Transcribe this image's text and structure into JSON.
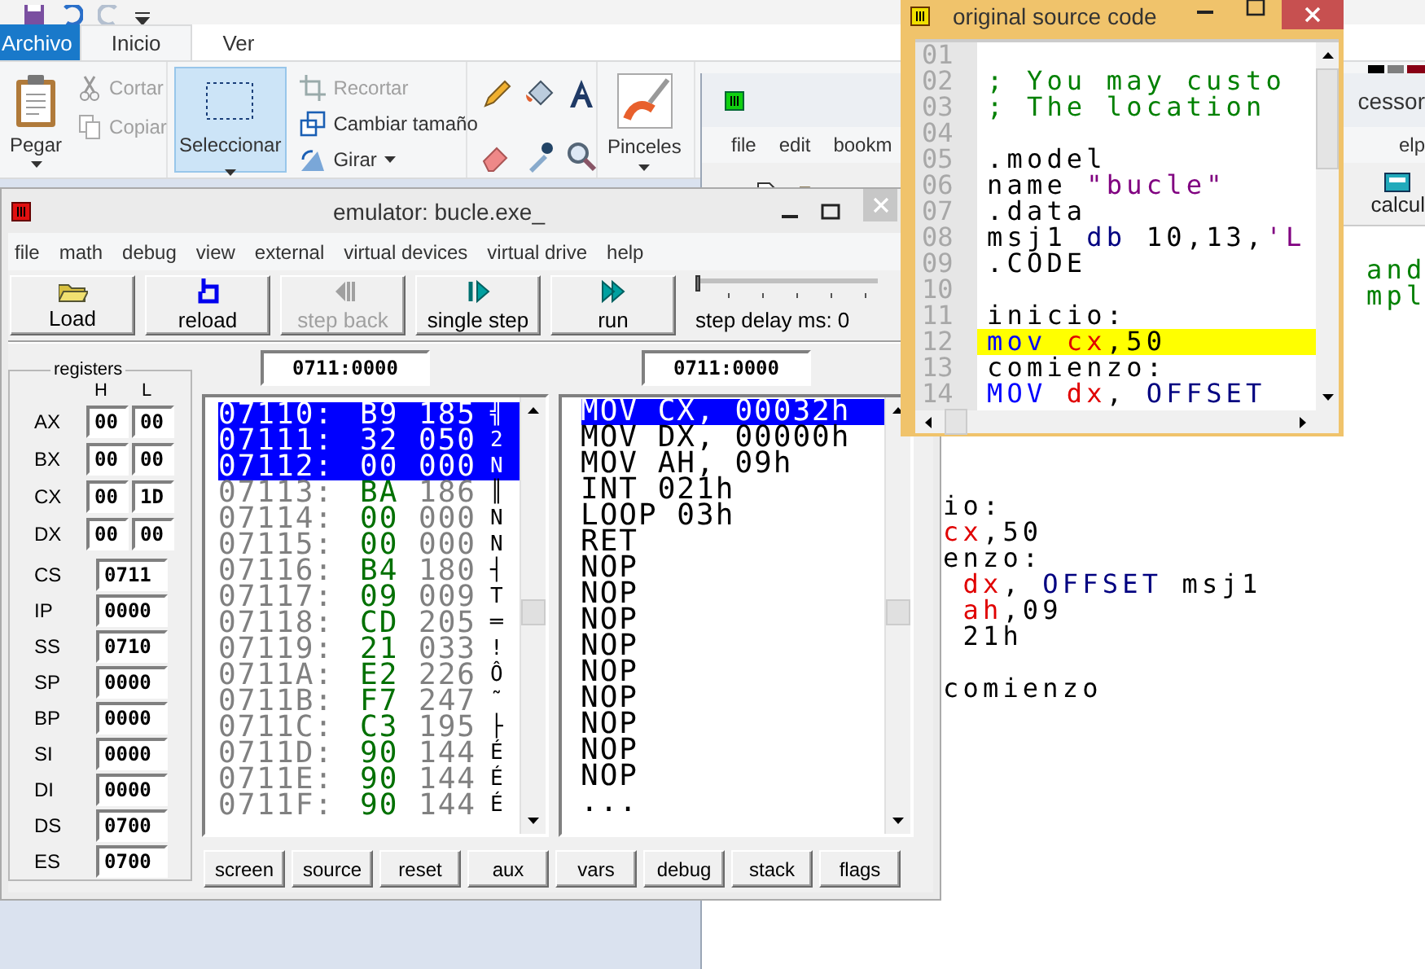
{
  "paint": {
    "tabs": [
      {
        "label": "Archivo",
        "kind": "file",
        "selected": false
      },
      {
        "label": "Inicio",
        "kind": "tab",
        "selected": true
      },
      {
        "label": "Ver",
        "kind": "tab",
        "selected": false
      }
    ],
    "clipboard": {
      "paste": "Pegar",
      "items": [
        {
          "label": "Cortar",
          "kind": "cut",
          "disabled": true
        },
        {
          "label": "Copiar",
          "kind": "copy",
          "disabled": true
        }
      ]
    },
    "image": {
      "select": {
        "label": "Seleccionar",
        "selected": true
      },
      "items": [
        {
          "label": "Recortar",
          "kind": "crop",
          "disabled": true
        },
        {
          "label": "Cambiar tamaño",
          "kind": "resize",
          "disabled": false
        },
        {
          "label": "Girar",
          "kind": "rotate",
          "disabled": false
        }
      ]
    },
    "brushes": "Pinceles"
  },
  "editor": {
    "title": "cessor",
    "menu": [
      "file",
      "edit",
      "bookm"
    ],
    "menu_right": "elp",
    "tool": "calcul",
    "side_lines": [
      {
        "text": "and",
        "kind": "comment"
      },
      {
        "text": "mpl",
        "kind": "comment"
      }
    ],
    "blocks": [
      {
        "lines": [
          {
            "segments": [
              {
                "text": "io:",
                "kind": "plain"
              }
            ]
          },
          {
            "segments": [
              {
                "text": "cx",
                "kind": "reg"
              },
              {
                "text": ",50",
                "kind": "plain"
              }
            ]
          },
          {
            "segments": [
              {
                "text": "enzo:",
                "kind": "plain"
              }
            ]
          },
          {
            "segments": [
              {
                "text": " dx",
                "kind": "reg"
              },
              {
                "text": ", ",
                "kind": "plain"
              },
              {
                "text": "OFFSET",
                "kind": "keyword"
              },
              {
                "text": " msj1",
                "kind": "plain"
              }
            ]
          },
          {
            "segments": [
              {
                "text": " ah",
                "kind": "reg"
              },
              {
                "text": ",09",
                "kind": "plain"
              }
            ]
          },
          {
            "segments": [
              {
                "text": " 21h",
                "kind": "plain"
              }
            ]
          }
        ]
      },
      {
        "lines": [
          {
            "segments": [
              {
                "text": "comienzo",
                "kind": "plain"
              }
            ]
          }
        ]
      }
    ]
  },
  "emulator": {
    "title": "emulator: bucle.exe_",
    "menu": [
      "file",
      "math",
      "debug",
      "view",
      "external",
      "virtual devices",
      "virtual drive",
      "help"
    ],
    "toolbar": [
      {
        "label": "Load",
        "kind": "load",
        "disabled": false
      },
      {
        "label": "reload",
        "kind": "reload",
        "disabled": false
      },
      {
        "label": "step back",
        "kind": "back",
        "disabled": true
      },
      {
        "label": "single step",
        "kind": "step",
        "disabled": false
      },
      {
        "label": "run",
        "kind": "run",
        "disabled": false
      }
    ],
    "step_delay": {
      "label": "step delay ms: 0",
      "level": 0
    },
    "registers": {
      "title": "registers",
      "columns": [
        "H",
        "L"
      ],
      "pairs": [
        {
          "name": "AX",
          "high": "00",
          "low": "00"
        },
        {
          "name": "BX",
          "high": "00",
          "low": "00"
        },
        {
          "name": "CX",
          "high": "00",
          "low": "1D"
        },
        {
          "name": "DX",
          "high": "00",
          "low": "00"
        }
      ],
      "words": [
        {
          "name": "CS",
          "value": "0711"
        },
        {
          "name": "IP",
          "value": "0000"
        },
        {
          "name": "SS",
          "value": "0710"
        },
        {
          "name": "SP",
          "value": "0000"
        },
        {
          "name": "BP",
          "value": "0000"
        },
        {
          "name": "SI",
          "value": "0000"
        },
        {
          "name": "DI",
          "value": "0000"
        },
        {
          "name": "DS",
          "value": "0700"
        },
        {
          "name": "ES",
          "value": "0700"
        }
      ]
    },
    "memory": {
      "address": "0711:0000",
      "rows": [
        {
          "address": "07110:",
          "hex": "B9",
          "dec": "185",
          "char": "╣",
          "selected": true
        },
        {
          "address": "07111:",
          "hex": "32",
          "dec": "050",
          "char": "2",
          "selected": true
        },
        {
          "address": "07112:",
          "hex": "00",
          "dec": "000",
          "char": "N",
          "selected": true
        },
        {
          "address": "07113:",
          "hex": "BA",
          "dec": "186",
          "char": "║",
          "selected": false
        },
        {
          "address": "07114:",
          "hex": "00",
          "dec": "000",
          "char": "N",
          "selected": false
        },
        {
          "address": "07115:",
          "hex": "00",
          "dec": "000",
          "char": "N",
          "selected": false
        },
        {
          "address": "07116:",
          "hex": "B4",
          "dec": "180",
          "char": "┤",
          "selected": false
        },
        {
          "address": "07117:",
          "hex": "09",
          "dec": "009",
          "char": "T",
          "selected": false
        },
        {
          "address": "07118:",
          "hex": "CD",
          "dec": "205",
          "char": "═",
          "selected": false
        },
        {
          "address": "07119:",
          "hex": "21",
          "dec": "033",
          "char": "!",
          "selected": false
        },
        {
          "address": "0711A:",
          "hex": "E2",
          "dec": "226",
          "char": "Ô",
          "selected": false
        },
        {
          "address": "0711B:",
          "hex": "F7",
          "dec": "247",
          "char": "˜",
          "selected": false
        },
        {
          "address": "0711C:",
          "hex": "C3",
          "dec": "195",
          "char": "├",
          "selected": false
        },
        {
          "address": "0711D:",
          "hex": "90",
          "dec": "144",
          "char": "É",
          "selected": false
        },
        {
          "address": "0711E:",
          "hex": "90",
          "dec": "144",
          "char": "É",
          "selected": false
        },
        {
          "address": "0711F:",
          "hex": "90",
          "dec": "144",
          "char": "É",
          "selected": false
        }
      ]
    },
    "disassembly": {
      "address": "0711:0000",
      "rows": [
        {
          "text": "MOV CX, 00032h",
          "selected": true
        },
        {
          "text": "MOV DX, 00000h",
          "selected": false
        },
        {
          "text": "MOV AH, 09h",
          "selected": false
        },
        {
          "text": "INT 021h",
          "selected": false
        },
        {
          "text": "LOOP 03h",
          "selected": false
        },
        {
          "text": "RET",
          "selected": false
        },
        {
          "text": "NOP",
          "selected": false
        },
        {
          "text": "NOP",
          "selected": false
        },
        {
          "text": "NOP",
          "selected": false
        },
        {
          "text": "NOP",
          "selected": false
        },
        {
          "text": "NOP",
          "selected": false
        },
        {
          "text": "NOP",
          "selected": false
        },
        {
          "text": "NOP",
          "selected": false
        },
        {
          "text": "NOP",
          "selected": false
        },
        {
          "text": "NOP",
          "selected": false
        },
        {
          "text": "...",
          "selected": false
        }
      ]
    },
    "buttons": [
      "screen",
      "source",
      "reset",
      "aux",
      "vars",
      "debug",
      "stack",
      "flags"
    ]
  },
  "source_window": {
    "title": "original source code",
    "lines": [
      {
        "number": "01",
        "highlighted": false
      },
      {
        "number": "02",
        "highlighted": false,
        "segments": [
          {
            "text": "; You may custo",
            "kind": "comment"
          }
        ]
      },
      {
        "number": "03",
        "highlighted": false,
        "segments": [
          {
            "text": "; The location",
            "kind": "comment"
          }
        ]
      },
      {
        "number": "04",
        "highlighted": false
      },
      {
        "number": "05",
        "highlighted": false,
        "segments": [
          {
            "text": ".model",
            "kind": "plain"
          }
        ]
      },
      {
        "number": "06",
        "highlighted": false,
        "segments": [
          {
            "text": "name ",
            "kind": "plain"
          },
          {
            "text": "\"bucle\"",
            "kind": "string"
          }
        ]
      },
      {
        "number": "07",
        "highlighted": false,
        "segments": [
          {
            "text": ".data",
            "kind": "plain"
          }
        ]
      },
      {
        "number": "08",
        "highlighted": false,
        "segments": [
          {
            "text": "msj1 ",
            "kind": "plain"
          },
          {
            "text": "db",
            "kind": "keyword"
          },
          {
            "text": " 10,13,",
            "kind": "plain"
          },
          {
            "text": "'L",
            "kind": "string"
          }
        ]
      },
      {
        "number": "09",
        "highlighted": false,
        "segments": [
          {
            "text": ".CODE",
            "kind": "plain"
          }
        ]
      },
      {
        "number": "10",
        "highlighted": false
      },
      {
        "number": "11",
        "highlighted": false,
        "segments": [
          {
            "text": "inicio:",
            "kind": "plain"
          }
        ]
      },
      {
        "number": "12",
        "highlighted": true,
        "segments": [
          {
            "text": "mov",
            "kind": "instr"
          },
          {
            "text": " cx",
            "kind": "reg"
          },
          {
            "text": ",50",
            "kind": "plain"
          }
        ]
      },
      {
        "number": "13",
        "highlighted": false,
        "segments": [
          {
            "text": "comienzo:",
            "kind": "plain"
          }
        ]
      },
      {
        "number": "14",
        "highlighted": false,
        "segments": [
          {
            "text": "MOV",
            "kind": "instr"
          },
          {
            "text": " dx",
            "kind": "reg"
          },
          {
            "text": ", ",
            "kind": "plain"
          },
          {
            "text": "OFFSET",
            "kind": "keyword"
          }
        ]
      }
    ]
  }
}
